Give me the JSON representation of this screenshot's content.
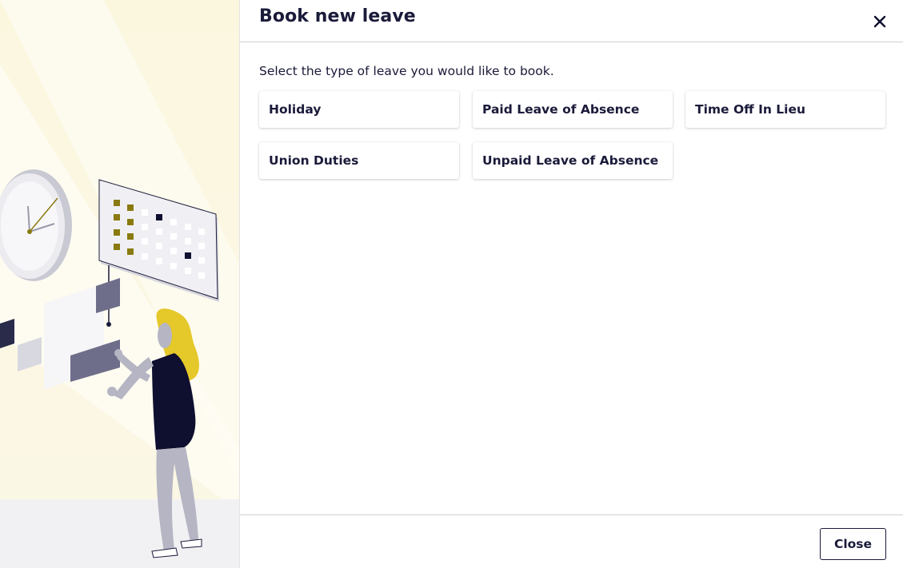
{
  "dialog": {
    "title": "Book new leave",
    "instruction": "Select the type of leave you would like to book.",
    "close_icon": "close-icon",
    "close_button_label": "Close"
  },
  "leave_types": [
    {
      "label": "Holiday"
    },
    {
      "label": "Paid Leave of Absence"
    },
    {
      "label": "Time Off In Lieu"
    },
    {
      "label": "Union Duties"
    },
    {
      "label": "Unpaid Leave of Absence"
    }
  ],
  "illustration": {
    "description_icon": "woman-with-calendar-and-clock-illustration"
  },
  "colors": {
    "text": "#1a1a3a",
    "accent_yellow": "#e5c82a",
    "accent_olive": "#8a7a10",
    "navy": "#0f0f30",
    "panel_bg": "#fbf7df"
  }
}
